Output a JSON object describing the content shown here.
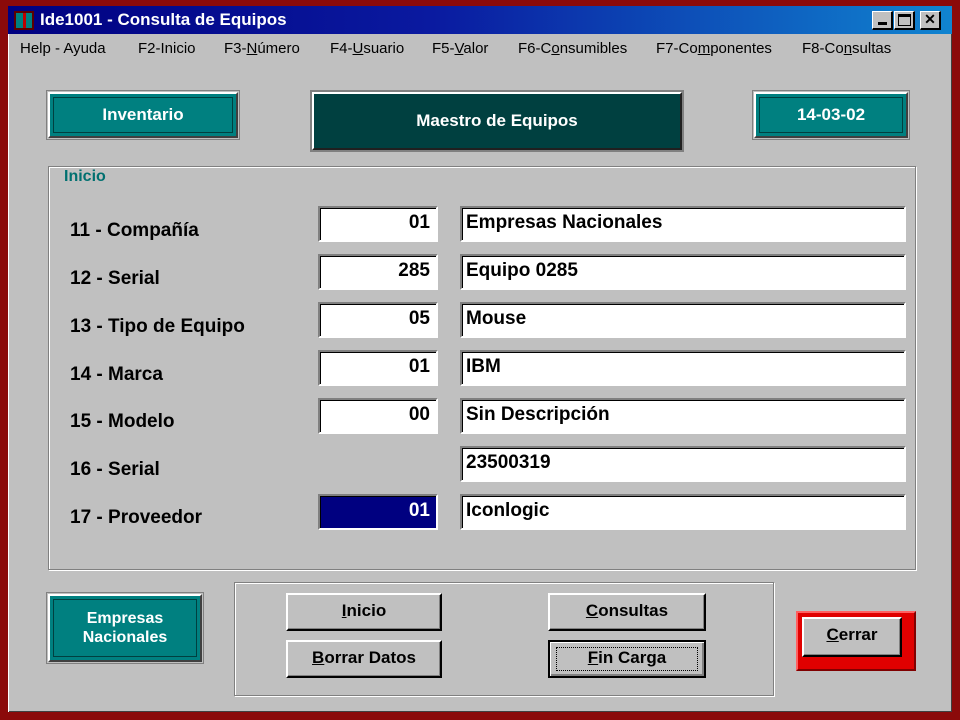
{
  "window": {
    "title": "Ide1001 - Consulta de Equipos"
  },
  "menu": [
    {
      "pre": "Help - Ayuda",
      "u": "",
      "post": ""
    },
    {
      "pre": "F2-Inicio",
      "u": "",
      "post": ""
    },
    {
      "pre": "F3-",
      "u": "N",
      "post": "úmero"
    },
    {
      "pre": "F4-",
      "u": "U",
      "post": "suario"
    },
    {
      "pre": "F5-",
      "u": "V",
      "post": "alor"
    },
    {
      "pre": "F6-C",
      "u": "o",
      "post": "nsumibles"
    },
    {
      "pre": "F7-Co",
      "u": "m",
      "post": "ponentes"
    },
    {
      "pre": "F8-Co",
      "u": "n",
      "post": "sultas"
    }
  ],
  "header": {
    "module": "Inventario",
    "title": "Maestro de Equipos",
    "date": "14-03-02"
  },
  "group": {
    "legend": "Inicio"
  },
  "fields": [
    {
      "label": "11 - Compañía",
      "code": "01",
      "desc": "Empresas Nacionales"
    },
    {
      "label": "12 - Serial",
      "code": "285",
      "desc": "Equipo 0285"
    },
    {
      "label": "13 - Tipo de Equipo",
      "code": "05",
      "desc": "Mouse"
    },
    {
      "label": "14 - Marca",
      "code": "01",
      "desc": "IBM"
    },
    {
      "label": "15 - Modelo",
      "code": "00",
      "desc": "Sin Descripción"
    },
    {
      "label": "16 - Serial",
      "code": null,
      "desc": "23500319"
    },
    {
      "label": "17 - Proveedor",
      "code": "01",
      "desc": "Iconlogic"
    }
  ],
  "company_badge": {
    "line1": "Empresas",
    "line2": "Nacionales"
  },
  "buttons": {
    "inicio": {
      "u": "I",
      "rest": "nicio"
    },
    "consultas": {
      "u": "C",
      "rest": "onsultas"
    },
    "borrar": {
      "u": "B",
      "rest": "orrar Datos"
    },
    "fin": {
      "u": "F",
      "rest": "in Carga"
    },
    "cerrar": {
      "u": "C",
      "rest": "errar"
    }
  }
}
